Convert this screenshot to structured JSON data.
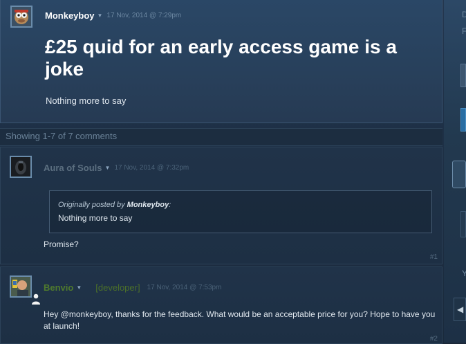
{
  "op": {
    "author": "Monkeyboy",
    "date": "17 Nov, 2014 @ 7:29pm",
    "title": "£25 quid for an early access game is a joke",
    "body": "Nothing more to say"
  },
  "showing_text": "Showing 1-7 of 7 comments",
  "comments": [
    {
      "author": "Aura of Souls",
      "date": "17 Nov, 2014 @ 7:32pm",
      "quote_prefix": "Originally posted by",
      "quote_author": "Monkeyboy",
      "quote_text": "Nothing more to say",
      "text": "Promise?",
      "number": "#1"
    },
    {
      "author": "Benvio",
      "tag": "[developer]",
      "date": "17 Nov, 2014 @ 7:53pm",
      "text": "Hey @monkeyboy, thanks for the feedback. What would be an acceptable price for you? Hope to have you at launch!",
      "number": "#2"
    }
  ],
  "sidebar": {
    "letters": [
      "D",
      "F",
      "Y"
    ]
  },
  "colors": {
    "background": "#1b2838",
    "developer_name": "#4f7a2d",
    "title": "#ffffff"
  }
}
